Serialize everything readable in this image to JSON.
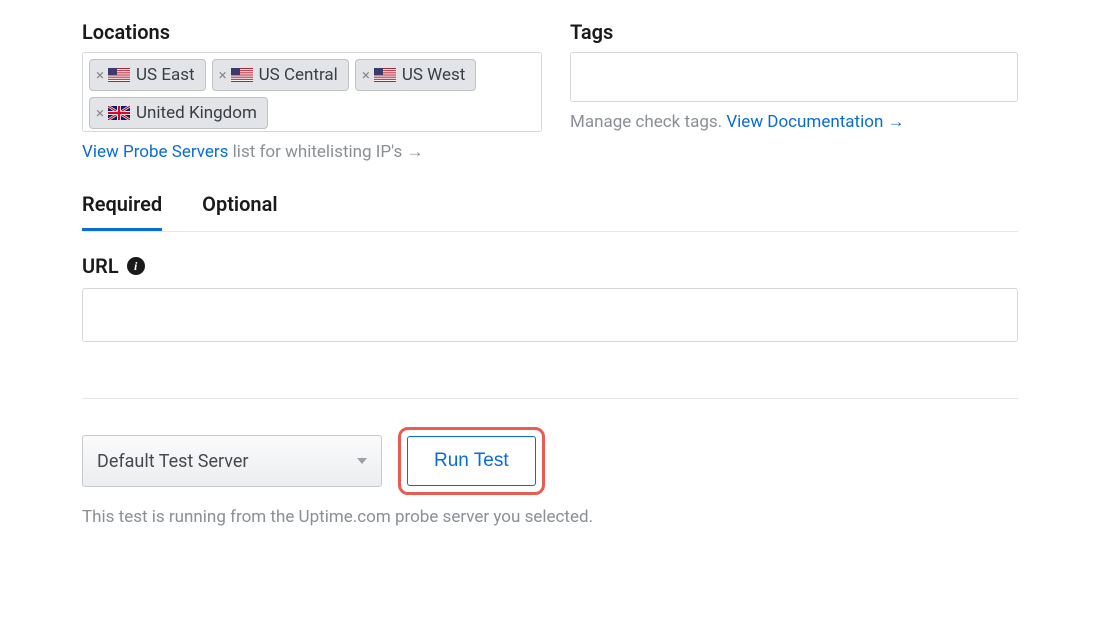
{
  "locations": {
    "label": "Locations",
    "chips": [
      {
        "flag": "us",
        "label": "US East"
      },
      {
        "flag": "us",
        "label": "US Central"
      },
      {
        "flag": "us",
        "label": "US West"
      },
      {
        "flag": "uk",
        "label": "United Kingdom"
      }
    ],
    "probe_link": "View Probe Servers",
    "probe_suffix": " list for whitelisting IP's →"
  },
  "tags": {
    "label": "Tags",
    "value": "",
    "manage_text": "Manage check tags. ",
    "doc_link": "View Documentation →"
  },
  "tabs": {
    "required": "Required",
    "optional": "Optional",
    "active": "required"
  },
  "url": {
    "label": "URL",
    "value": ""
  },
  "run": {
    "server_selected": "Default Test Server",
    "button": "Run Test",
    "note": "This test is running from the Uptime.com probe server you selected."
  }
}
